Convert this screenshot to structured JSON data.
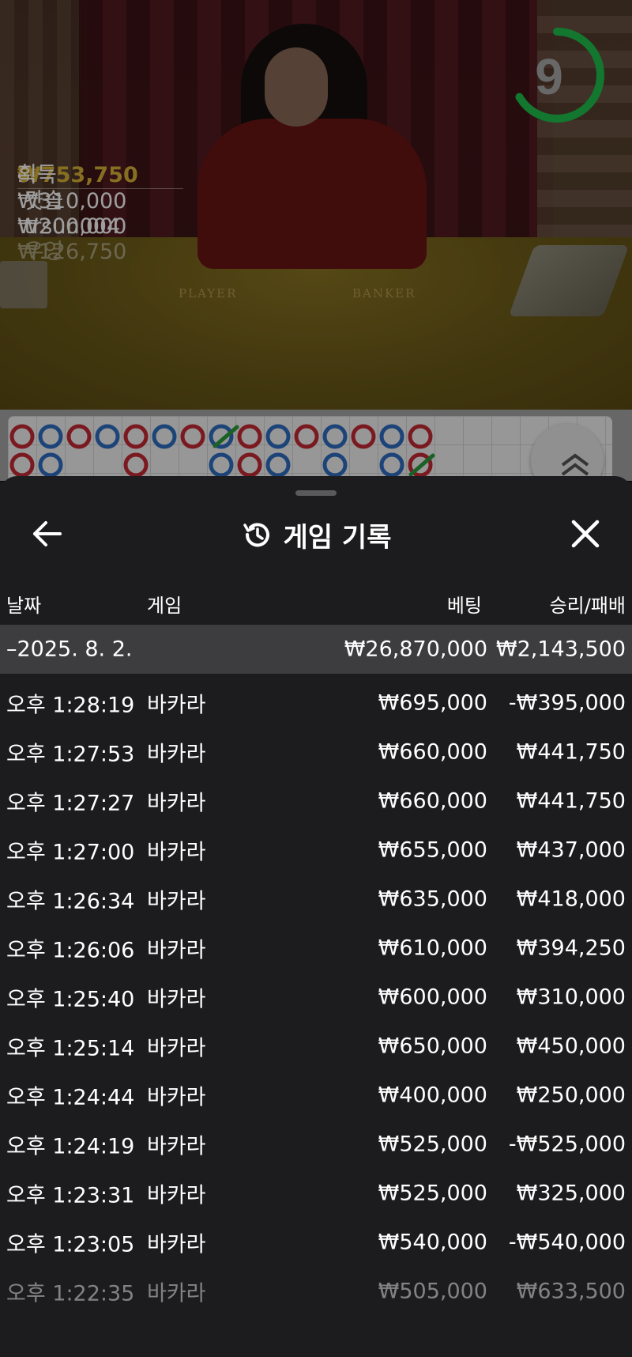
{
  "video": {
    "timer": "9",
    "table_labels": {
      "player": "PLAYER",
      "banker": "BANKER"
    },
    "winners": {
      "count": "5",
      "total": "₩753,750",
      "suffix": "획득",
      "list": [
        {
          "amount": "₩310,000",
          "name": "캿솔"
        },
        {
          "amount": "₩200,000",
          "name": "trsun004"
        },
        {
          "amount": "₩126,750",
          "name": "우영"
        }
      ]
    },
    "colors": {
      "timer_ring": "#1fc04e",
      "banker": "#c62a34",
      "player": "#2f6fc2",
      "tie": "#2c9b3a",
      "gold": "#d8b437"
    }
  },
  "sheet": {
    "title": "게임 기록",
    "icons": {
      "back": "arrow-left-icon",
      "history": "history-icon",
      "close": "close-icon"
    },
    "columns": {
      "date": "날짜",
      "game": "게임",
      "bet": "베팅",
      "result": "승리/패배"
    },
    "summary": {
      "date": "–2025. 8. 2.",
      "bet": "₩26,870,000",
      "result": "₩2,143,500"
    },
    "rows": [
      {
        "time": "오후 1:28:19",
        "game": "바카라",
        "bet": "₩695,000",
        "result": "-₩395,000"
      },
      {
        "time": "오후 1:27:53",
        "game": "바카라",
        "bet": "₩660,000",
        "result": "₩441,750"
      },
      {
        "time": "오후 1:27:27",
        "game": "바카라",
        "bet": "₩660,000",
        "result": "₩441,750"
      },
      {
        "time": "오후 1:27:00",
        "game": "바카라",
        "bet": "₩655,000",
        "result": "₩437,000"
      },
      {
        "time": "오후 1:26:34",
        "game": "바카라",
        "bet": "₩635,000",
        "result": "₩418,000"
      },
      {
        "time": "오후 1:26:06",
        "game": "바카라",
        "bet": "₩610,000",
        "result": "₩394,250"
      },
      {
        "time": "오후 1:25:40",
        "game": "바카라",
        "bet": "₩600,000",
        "result": "₩310,000"
      },
      {
        "time": "오후 1:25:14",
        "game": "바카라",
        "bet": "₩650,000",
        "result": "₩450,000"
      },
      {
        "time": "오후 1:24:44",
        "game": "바카라",
        "bet": "₩400,000",
        "result": "₩250,000"
      },
      {
        "time": "오후 1:24:19",
        "game": "바카라",
        "bet": "₩525,000",
        "result": "-₩525,000"
      },
      {
        "time": "오후 1:23:31",
        "game": "바카라",
        "bet": "₩525,000",
        "result": "₩325,000"
      },
      {
        "time": "오후 1:23:05",
        "game": "바카라",
        "bet": "₩540,000",
        "result": "-₩540,000"
      },
      {
        "time": "오후 1:22:35",
        "game": "바카라",
        "bet": "₩505,000",
        "result": "₩633,500"
      }
    ]
  }
}
